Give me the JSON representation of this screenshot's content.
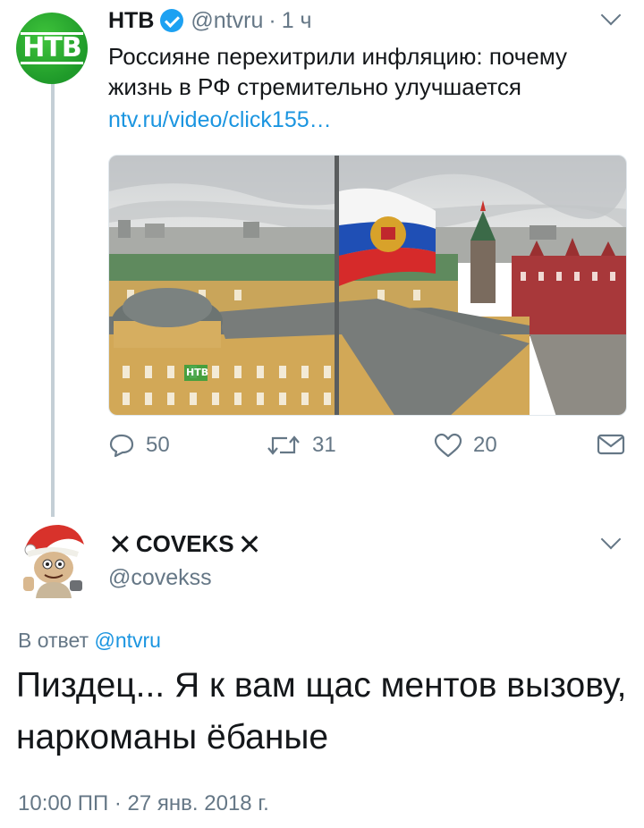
{
  "tweet1": {
    "avatar_logo": "НТВ",
    "name": "НТВ",
    "handle": "@ntvru",
    "separator": "·",
    "time": "1 ч",
    "text": "Россияне перехитрили инфляцию: почему жизнь в РФ стремительно улучшается",
    "link": "ntv.ru/video/click155…",
    "media_watermark": "НТВ",
    "actions": {
      "replies": "50",
      "retweets": "31",
      "likes": "20"
    }
  },
  "tweet2": {
    "name": "COVEKS",
    "name_decoration": "✕",
    "handle": "@covekss",
    "reply_prefix": "В ответ",
    "reply_mention": "@ntvru",
    "text": "Пиздец... Я к вам щас ментов вызову, наркоманы ёбаные",
    "timestamp": "10:00 ПП · 27 янв. 2018 г."
  },
  "colors": {
    "accent": "#1da1f2",
    "link": "#1b95e0",
    "muted": "#657786",
    "ntv_green": "#28a832"
  },
  "icons": [
    "verified-icon",
    "chevron-down-icon",
    "reply-icon",
    "retweet-icon",
    "like-icon",
    "direct-message-icon"
  ]
}
